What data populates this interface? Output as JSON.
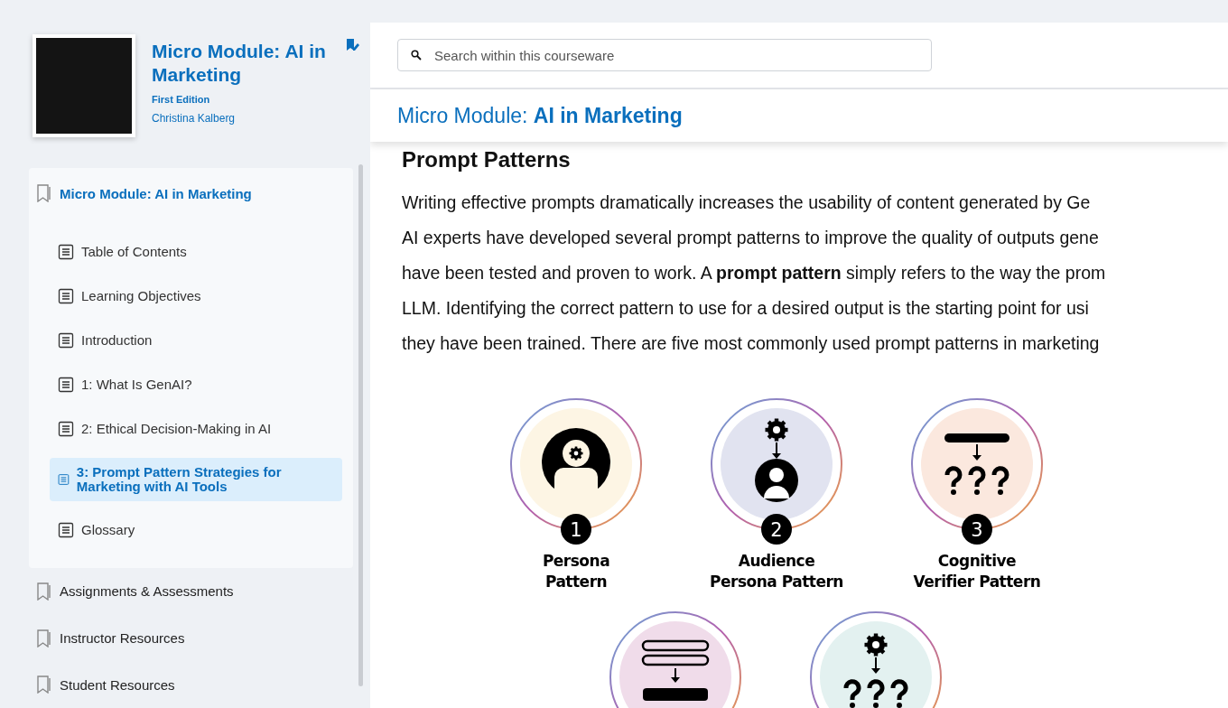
{
  "book": {
    "title": "Micro Module: AI in Marketing",
    "edition": "First Edition",
    "author": "Christina Kalberg"
  },
  "toc": {
    "heading": "Micro Module: AI in Marketing",
    "items": [
      {
        "label": "Table of Contents",
        "selected": false
      },
      {
        "label": "Learning Objectives",
        "selected": false
      },
      {
        "label": "Introduction",
        "selected": false
      },
      {
        "label": "1: What Is GenAI?",
        "selected": false
      },
      {
        "label": "2: Ethical Decision-Making in AI",
        "selected": false
      },
      {
        "label": "3: Prompt Pattern Strategies for Marketing with AI Tools",
        "selected": true
      },
      {
        "label": "Glossary",
        "selected": false
      }
    ]
  },
  "sections": [
    "Assignments & Assessments",
    "Instructor Resources",
    "Student Resources"
  ],
  "search": {
    "placeholder": "Search within this courseware"
  },
  "breadcrumb": "Micro Module: **AI in Marketing**",
  "content": {
    "heading": "Prompt Patterns",
    "lines": [
      "Writing effective prompts dramatically increases the usability of content generated by Ge",
      "AI experts have developed several prompt patterns to improve the quality of outputs gene",
      "have been tested and proven to work. A **prompt pattern** simply refers to the way the prom",
      "LLM. Identifying the correct pattern to use for a desired output is the starting point for usi",
      "they have been trained. There are five most commonly used prompt patterns in marketing"
    ]
  },
  "patterns": [
    {
      "kind": "persona",
      "color": "#fdf5e4",
      "number": "1",
      "label": [
        "Persona",
        "Pattern"
      ]
    },
    {
      "kind": "audience",
      "color": "#e1e3f0",
      "number": "2",
      "label": [
        "Audience",
        "Persona Pattern"
      ]
    },
    {
      "kind": "verifier",
      "color": "#fbe8de",
      "number": "3",
      "label": [
        "Cognitive",
        "Verifier Pattern"
      ]
    },
    {
      "kind": "list",
      "color": "#f0dcea"
    },
    {
      "kind": "gear-questions",
      "color": "#e3f1f0"
    }
  ]
}
